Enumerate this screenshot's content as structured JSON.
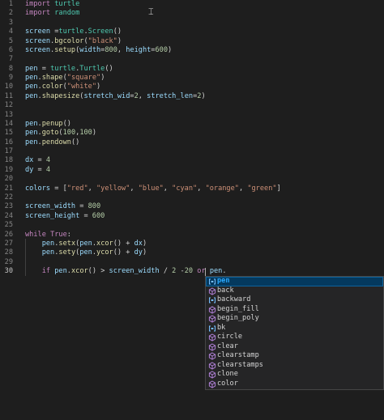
{
  "editor": {
    "lines": [
      {
        "n": "1",
        "tokens": [
          {
            "t": "import",
            "c": "kw"
          },
          {
            "t": " "
          },
          {
            "t": "turtle",
            "c": "mod"
          }
        ]
      },
      {
        "n": "2",
        "tokens": [
          {
            "t": "import",
            "c": "kw"
          },
          {
            "t": " "
          },
          {
            "t": "random",
            "c": "mod"
          }
        ]
      },
      {
        "n": "3",
        "tokens": []
      },
      {
        "n": "4",
        "tokens": [
          {
            "t": "screen",
            "c": "id"
          },
          {
            "t": " ="
          },
          {
            "t": "turtle",
            "c": "mod"
          },
          {
            "t": "."
          },
          {
            "t": "Screen",
            "c": "mod"
          },
          {
            "t": "()"
          }
        ]
      },
      {
        "n": "5",
        "tokens": [
          {
            "t": "screen",
            "c": "id"
          },
          {
            "t": "."
          },
          {
            "t": "bgcolor",
            "c": "fn"
          },
          {
            "t": "("
          },
          {
            "t": "\"black\"",
            "c": "str"
          },
          {
            "t": ")"
          }
        ]
      },
      {
        "n": "6",
        "tokens": [
          {
            "t": "screen",
            "c": "id"
          },
          {
            "t": "."
          },
          {
            "t": "setup",
            "c": "fn"
          },
          {
            "t": "("
          },
          {
            "t": "width",
            "c": "id"
          },
          {
            "t": "="
          },
          {
            "t": "800",
            "c": "num"
          },
          {
            "t": ", "
          },
          {
            "t": "height",
            "c": "id"
          },
          {
            "t": "="
          },
          {
            "t": "600",
            "c": "num"
          },
          {
            "t": ")"
          }
        ]
      },
      {
        "n": "7",
        "tokens": []
      },
      {
        "n": "8",
        "tokens": [
          {
            "t": "pen",
            "c": "id"
          },
          {
            "t": " = "
          },
          {
            "t": "turtle",
            "c": "mod"
          },
          {
            "t": "."
          },
          {
            "t": "Turtle",
            "c": "mod"
          },
          {
            "t": "()"
          }
        ]
      },
      {
        "n": "9",
        "tokens": [
          {
            "t": "pen",
            "c": "id"
          },
          {
            "t": "."
          },
          {
            "t": "shape",
            "c": "fn"
          },
          {
            "t": "("
          },
          {
            "t": "\"square\"",
            "c": "str"
          },
          {
            "t": ")"
          }
        ]
      },
      {
        "n": "10",
        "tokens": [
          {
            "t": "pen",
            "c": "id"
          },
          {
            "t": "."
          },
          {
            "t": "color",
            "c": "fn"
          },
          {
            "t": "("
          },
          {
            "t": "\"white\"",
            "c": "str"
          },
          {
            "t": ")"
          }
        ]
      },
      {
        "n": "11",
        "tokens": [
          {
            "t": "pen",
            "c": "id"
          },
          {
            "t": "."
          },
          {
            "t": "shapesize",
            "c": "fn"
          },
          {
            "t": "("
          },
          {
            "t": "stretch_wid",
            "c": "id"
          },
          {
            "t": "="
          },
          {
            "t": "2",
            "c": "num"
          },
          {
            "t": ", "
          },
          {
            "t": "stretch_len",
            "c": "id"
          },
          {
            "t": "="
          },
          {
            "t": "2",
            "c": "num"
          },
          {
            "t": ")"
          }
        ]
      },
      {
        "n": "12",
        "tokens": []
      },
      {
        "n": "13",
        "tokens": []
      },
      {
        "n": "14",
        "tokens": [
          {
            "t": "pen",
            "c": "id"
          },
          {
            "t": "."
          },
          {
            "t": "penup",
            "c": "fn"
          },
          {
            "t": "()"
          }
        ]
      },
      {
        "n": "15",
        "tokens": [
          {
            "t": "pen",
            "c": "id"
          },
          {
            "t": "."
          },
          {
            "t": "goto",
            "c": "fn"
          },
          {
            "t": "("
          },
          {
            "t": "100",
            "c": "num"
          },
          {
            "t": ","
          },
          {
            "t": "100",
            "c": "num"
          },
          {
            "t": ")"
          }
        ]
      },
      {
        "n": "16",
        "tokens": [
          {
            "t": "pen",
            "c": "id"
          },
          {
            "t": "."
          },
          {
            "t": "pendown",
            "c": "fn"
          },
          {
            "t": "()"
          }
        ]
      },
      {
        "n": "17",
        "tokens": []
      },
      {
        "n": "18",
        "tokens": [
          {
            "t": "dx",
            "c": "id"
          },
          {
            "t": " = "
          },
          {
            "t": "4",
            "c": "num"
          }
        ]
      },
      {
        "n": "19",
        "tokens": [
          {
            "t": "dy",
            "c": "id"
          },
          {
            "t": " = "
          },
          {
            "t": "4",
            "c": "num"
          }
        ]
      },
      {
        "n": "20",
        "tokens": []
      },
      {
        "n": "21",
        "tokens": [
          {
            "t": "colors",
            "c": "id"
          },
          {
            "t": " = ["
          },
          {
            "t": "\"red\"",
            "c": "str"
          },
          {
            "t": ", "
          },
          {
            "t": "\"yellow\"",
            "c": "str"
          },
          {
            "t": ", "
          },
          {
            "t": "\"blue\"",
            "c": "str"
          },
          {
            "t": ", "
          },
          {
            "t": "\"cyan\"",
            "c": "str"
          },
          {
            "t": ", "
          },
          {
            "t": "\"orange\"",
            "c": "str"
          },
          {
            "t": ", "
          },
          {
            "t": "\"green\"",
            "c": "str"
          },
          {
            "t": "]"
          }
        ]
      },
      {
        "n": "22",
        "tokens": []
      },
      {
        "n": "23",
        "tokens": [
          {
            "t": "screen_width",
            "c": "id"
          },
          {
            "t": " = "
          },
          {
            "t": "800",
            "c": "num"
          }
        ]
      },
      {
        "n": "24",
        "tokens": [
          {
            "t": "screen_height",
            "c": "id"
          },
          {
            "t": " = "
          },
          {
            "t": "600",
            "c": "num"
          }
        ]
      },
      {
        "n": "25",
        "tokens": []
      },
      {
        "n": "26",
        "tokens": [
          {
            "t": "while",
            "c": "kw"
          },
          {
            "t": " "
          },
          {
            "t": "True",
            "c": "kw"
          },
          {
            "t": ":"
          }
        ]
      },
      {
        "n": "27",
        "tokens": [
          {
            "t": "    "
          },
          {
            "t": "pen",
            "c": "id"
          },
          {
            "t": "."
          },
          {
            "t": "setx",
            "c": "fn"
          },
          {
            "t": "("
          },
          {
            "t": "pen",
            "c": "id"
          },
          {
            "t": "."
          },
          {
            "t": "xcor",
            "c": "fn"
          },
          {
            "t": "() + "
          },
          {
            "t": "dx",
            "c": "id"
          },
          {
            "t": ")"
          }
        ]
      },
      {
        "n": "28",
        "tokens": [
          {
            "t": "    "
          },
          {
            "t": "pen",
            "c": "id"
          },
          {
            "t": "."
          },
          {
            "t": "sety",
            "c": "fn"
          },
          {
            "t": "("
          },
          {
            "t": "pen",
            "c": "id"
          },
          {
            "t": "."
          },
          {
            "t": "ycor",
            "c": "fn"
          },
          {
            "t": "() + "
          },
          {
            "t": "dy",
            "c": "id"
          },
          {
            "t": ")"
          }
        ]
      },
      {
        "n": "29",
        "tokens": []
      },
      {
        "n": "30",
        "tokens": [
          {
            "t": "    "
          },
          {
            "t": "if",
            "c": "kw"
          },
          {
            "t": " "
          },
          {
            "t": "pen",
            "c": "id"
          },
          {
            "t": "."
          },
          {
            "t": "xcor",
            "c": "fn"
          },
          {
            "t": "() > "
          },
          {
            "t": "screen_width",
            "c": "id"
          },
          {
            "t": " / "
          },
          {
            "t": "2",
            "c": "num"
          },
          {
            "t": " -"
          },
          {
            "t": "20",
            "c": "num"
          },
          {
            "t": " "
          },
          {
            "t": "or",
            "c": "kw"
          },
          {
            "t": " "
          },
          {
            "t": "pen",
            "c": "id"
          },
          {
            "t": "."
          }
        ]
      }
    ],
    "active_line": "30"
  },
  "suggest": {
    "items": [
      {
        "label": "pen",
        "kind": "variable",
        "selected": true,
        "match": 3
      },
      {
        "label": "back",
        "kind": "method"
      },
      {
        "label": "backward",
        "kind": "variable"
      },
      {
        "label": "begin_fill",
        "kind": "method"
      },
      {
        "label": "begin_poly",
        "kind": "method"
      },
      {
        "label": "bk",
        "kind": "variable"
      },
      {
        "label": "circle",
        "kind": "method"
      },
      {
        "label": "clear",
        "kind": "method"
      },
      {
        "label": "clearstamp",
        "kind": "method"
      },
      {
        "label": "clearstamps",
        "kind": "method"
      },
      {
        "label": "clone",
        "kind": "method"
      },
      {
        "label": "color",
        "kind": "method"
      }
    ]
  },
  "colors": {
    "background": "#1e1e1e",
    "keyword": "#c586c0",
    "identifier": "#9cdcfe",
    "function": "#dcdcaa",
    "string": "#ce9178",
    "number": "#b5cea8",
    "module": "#4ec9b0",
    "method_icon": "#b180d7",
    "variable_icon": "#75beff",
    "selection": "#04395e"
  }
}
